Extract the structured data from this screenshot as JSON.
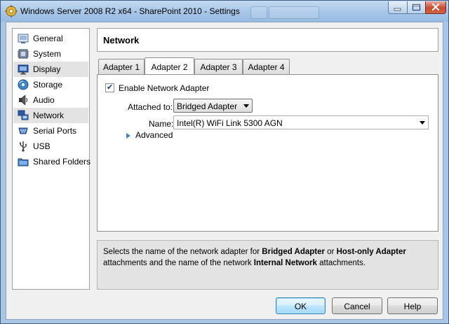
{
  "window": {
    "title": "Windows Server 2008 R2 x64 - SharePoint 2010 - Settings"
  },
  "sidebar": {
    "items": [
      {
        "label": "General",
        "icon": "general-icon"
      },
      {
        "label": "System",
        "icon": "system-chip-icon"
      },
      {
        "label": "Display",
        "icon": "monitor-icon",
        "selected": true
      },
      {
        "label": "Storage",
        "icon": "disk-icon"
      },
      {
        "label": "Audio",
        "icon": "speaker-icon"
      },
      {
        "label": "Network",
        "icon": "network-icon"
      },
      {
        "label": "Serial Ports",
        "icon": "serial-port-icon"
      },
      {
        "label": "USB",
        "icon": "usb-icon"
      },
      {
        "label": "Shared Folders",
        "icon": "folder-icon"
      }
    ]
  },
  "page": {
    "title": "Network"
  },
  "tabs": [
    {
      "label": "Adapter 1"
    },
    {
      "label": "Adapter 2",
      "active": true
    },
    {
      "label": "Adapter 3"
    },
    {
      "label": "Adapter 4"
    }
  ],
  "adapter": {
    "enable_label": "Enable Network Adapter",
    "enabled": true,
    "attached_label": "Attached to:",
    "attached_value": "Bridged Adapter",
    "name_label": "Name:",
    "name_value": "Intel(R) WiFi Link 5300 AGN",
    "advanced_label": "Advanced"
  },
  "info": {
    "t1": "Selects the name of the network adapter for ",
    "b1": "Bridged Adapter",
    "t2": " or ",
    "b2": "Host-only Adapter",
    "t3": " attachments and the name of the network ",
    "b3": "Internal Network",
    "t4": " attachments."
  },
  "buttons": {
    "ok": "OK",
    "cancel": "Cancel",
    "help": "Help"
  },
  "colors": {
    "title_bar": "#a8c7e8",
    "close_button": "#c74a31",
    "expander_accent": "#4a7fc1",
    "default_button": "#bee6fd"
  }
}
